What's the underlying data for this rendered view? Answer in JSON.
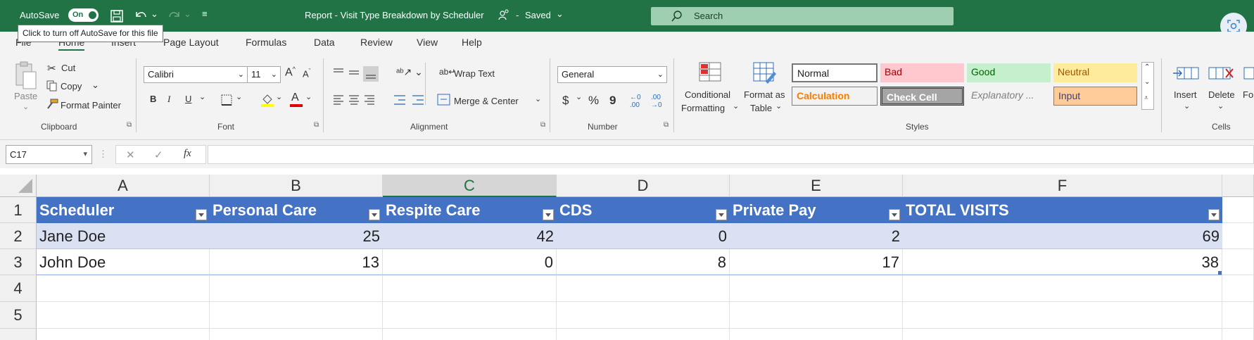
{
  "titlebar": {
    "autosave_label": "AutoSave",
    "toggle_label": "On",
    "doc_title": "Report - Visit Type Breakdown by Scheduler",
    "saved_status": "Saved",
    "search_placeholder": "Search",
    "tooltip": "Click to turn off AutoSave for this file"
  },
  "menu": [
    "File",
    "Home",
    "Insert",
    "Page Layout",
    "Formulas",
    "Data",
    "Review",
    "View",
    "Help"
  ],
  "ribbon": {
    "clipboard": {
      "paste": "Paste",
      "cut": "Cut",
      "copy": "Copy",
      "format_painter": "Format Painter",
      "label": "Clipboard"
    },
    "font": {
      "name": "Calibri",
      "size": "11",
      "bold": "B",
      "italic": "I",
      "underline": "U",
      "label": "Font"
    },
    "alignment": {
      "wrap_text": "Wrap Text",
      "merge_center": "Merge & Center",
      "label": "Alignment"
    },
    "number": {
      "format": "General",
      "currency": "$",
      "percent": "%",
      "comma": "9",
      "label": "Number"
    },
    "styles": {
      "conditional_formatting_1": "Conditional",
      "conditional_formatting_2": "Formatting",
      "format_as_table_1": "Format as",
      "format_as_table_2": "Table",
      "cells": [
        "Normal",
        "Bad",
        "Good",
        "Neutral",
        "Calculation",
        "Check Cell",
        "Explanatory ...",
        "Input"
      ],
      "label": "Styles"
    },
    "cells": {
      "insert": "Insert",
      "delete": "Delete",
      "format": "Fo",
      "label": "Cells"
    }
  },
  "formula_bar": {
    "name_box": "C17",
    "fx": "fx",
    "cancel": "✕",
    "enter": "✓",
    "content": ""
  },
  "sheet": {
    "columns": [
      "A",
      "B",
      "C",
      "D",
      "E",
      "F"
    ],
    "rows": [
      "1",
      "2",
      "3",
      "4",
      "5"
    ],
    "headers": [
      "Scheduler",
      "Personal Care",
      "Respite Care",
      "CDS",
      "Private Pay",
      "TOTAL VISITS"
    ],
    "data": [
      [
        "Jane Doe",
        "25",
        "42",
        "0",
        "2",
        "69"
      ],
      [
        "John Doe",
        "13",
        "0",
        "8",
        "17",
        "38"
      ]
    ]
  },
  "colors": {
    "excel_green": "#217346",
    "table_header": "#4472c4",
    "table_band": "#d9e1f2"
  }
}
